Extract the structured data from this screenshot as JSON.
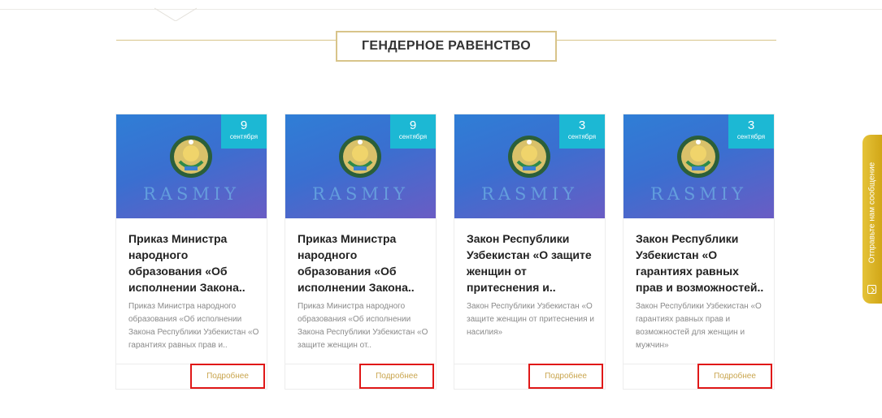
{
  "section": {
    "title": "ГЕНДЕРНОЕ РАВЕНСТВО"
  },
  "cards": [
    {
      "image_text": "RASMIY",
      "date_day": "9",
      "date_month": "сентября",
      "title": "Приказ Министра народного образования «Об исполнении Закона..",
      "description": "Приказ Министра народного образования «Об исполнении Закона Республики Узбекистан «О гарантиях равных прав и..",
      "more_label": "Подробнее"
    },
    {
      "image_text": "RASMIY",
      "date_day": "9",
      "date_month": "сентября",
      "title": "Приказ Министра народного образования «Об исполнении Закона..",
      "description": "Приказ Министра народного образования «Об исполнении Закона Республики Узбекистан «О защите женщин от..",
      "more_label": "Подробнее"
    },
    {
      "image_text": "RASMIY",
      "date_day": "3",
      "date_month": "сентября",
      "title": "Закон Республики Узбекистан «О защите женщин от притеснения и..",
      "description": "Закон Республики Узбекистан «О защите женщин от притеснения и насилия»",
      "more_label": "Подробнее"
    },
    {
      "image_text": "RASMIY",
      "date_day": "3",
      "date_month": "сентября",
      "title": "Закон Республики Узбекистан «О гарантиях равных прав и возможностей..",
      "description": "Закон Республики Узбекистан «О гарантиях равных прав и возможностей для женщин и мужчин»",
      "more_label": "Подробнее"
    }
  ],
  "feedback_tab": {
    "label": "Отправьте нам сообщение",
    "icon": "message-icon"
  },
  "colors": {
    "accent_gold": "#d8c48a",
    "date_badge": "#1cb8d4",
    "more_link": "#c9a54e",
    "highlight_border": "#e01818",
    "feedback_tab": "#dcb629"
  }
}
